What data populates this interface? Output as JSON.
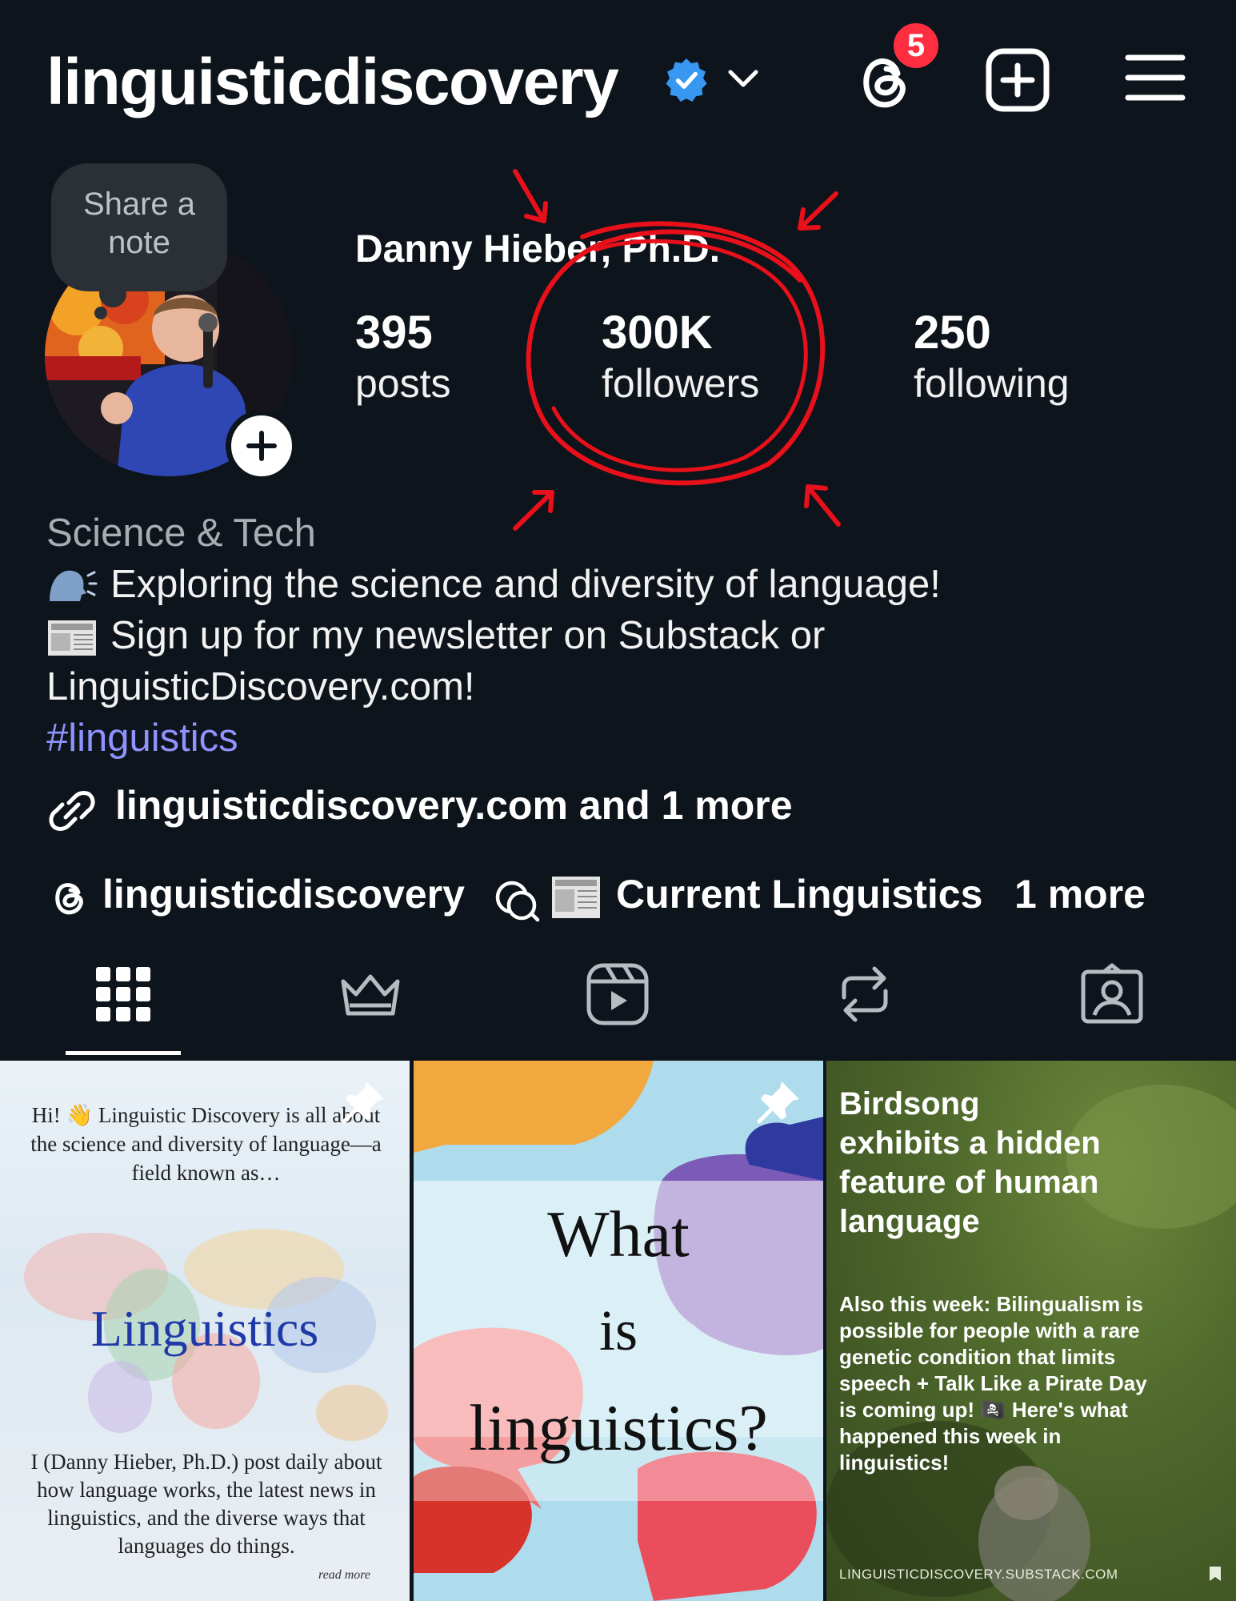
{
  "header": {
    "username": "linguisticdiscovery",
    "notification_count": "5"
  },
  "profile": {
    "note_text": "Share a note",
    "full_name": "Danny Hieber, Ph.D.",
    "stats": {
      "posts_count": "395",
      "posts_label": "posts",
      "followers_count": "300K",
      "followers_label": "followers",
      "following_count": "250",
      "following_label": "following"
    }
  },
  "bio": {
    "category": "Science & Tech",
    "line1": "Exploring the science and diversity of language!",
    "line2": "Sign up for my newsletter on Substack or",
    "line3": "LinguisticDiscovery.com!",
    "hashtag": "#linguistics",
    "link_text": "linguisticdiscovery.com and 1 more"
  },
  "chips": {
    "threads_handle": "linguisticdiscovery",
    "channel_name": "Current Linguistics",
    "more_label": "1 more"
  },
  "tabs": [
    {
      "icon": "grid-icon",
      "active": true
    },
    {
      "icon": "crown-icon",
      "active": false
    },
    {
      "icon": "reels-icon",
      "active": false
    },
    {
      "icon": "repost-icon",
      "active": false
    },
    {
      "icon": "tagged-icon",
      "active": false
    }
  ],
  "posts": {
    "post1": {
      "top_text": "Hi! 👋 Linguistic Discovery is all about the science and diversity of language—a field known as…",
      "title": "Linguistics",
      "bottom_text": "I (Danny Hieber, Ph.D.) post daily about how language works, the latest news in linguistics, and the diverse ways that languages do things.",
      "read_more": "read more"
    },
    "post2": {
      "word1": "What",
      "word2": "is",
      "word3": "linguistics?"
    },
    "post3": {
      "headline": "Birdsong exhibits a hidden feature of human language",
      "body": "Also this week: Bilingualism is possible for people with a rare genetic condition that limits speech + Talk Like a Pirate Day is coming up! 🏴‍☠️ Here's what happened this week in linguistics!",
      "footer": "LINGUISTICDISCOVERY.SUBSTACK.COM"
    }
  },
  "colors": {
    "background": "#0e141b",
    "accent_red": "#e8101b",
    "hashtag_blue": "#8f93ff",
    "verified_blue": "#3897f0",
    "badge_red": "#ff2d40"
  }
}
